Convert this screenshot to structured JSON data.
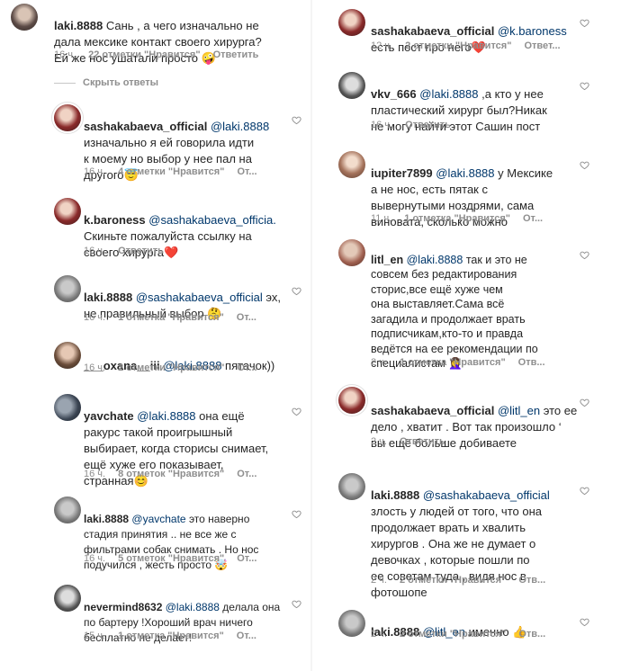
{
  "left": [
    {
      "user": "laki.8888",
      "text": "Сань , а чего изначально не\nдала мексике контакт своего хирурга?\nЕй же нос ушатали просто 🤪",
      "time": "16 ч.",
      "likes": "22 отметки \"Нравится\"",
      "reply": "Ответить"
    },
    {
      "user": "sashakabaeva_official",
      "mention": "@laki.8888",
      "text": "изначально я ей говорила идти\nк моему но выбор у нее пал на\nдругого😇",
      "time": "16 ч.",
      "likes": "4 отметки \"Нравится\"",
      "reply": "От..."
    },
    {
      "user": "k.baroness",
      "mention": "@sashakabaeva_officia.",
      "text": "Скиньте пожалуйста ссылку на\nсвоего хирурга❤️",
      "time": "16 ч.",
      "likes": "",
      "reply": "Ответить"
    },
    {
      "user": "laki.8888",
      "mention": "@sashakabaeva_official",
      "text_tail": " эх,",
      "text": "не правильный выбор 🤔",
      "time": "16 ч.",
      "likes": "1 отметка \"Нравится\"",
      "reply": "От..."
    },
    {
      "user": "___oxana__iii",
      "mention": "@laki.8888",
      "text_tail": " пятачок))",
      "time": "16 ч.",
      "likes": "2 отметки \"Нравится\"",
      "reply": "От..."
    },
    {
      "user": "yavchate",
      "mention": "@laki.8888",
      "text_tail": " она ещё",
      "text": "ракурс такой проигрышный\nвыбирает, когда сторисы снимает,\nещё хуже его показывает,\nстранная😊",
      "time": "16 ч.",
      "likes": "8 отметок \"Нравится\"",
      "reply": "От..."
    },
    {
      "user": "laki.8888",
      "mention": "@yavchate",
      "text_tail": " это наверно",
      "text": "стадия принятия .. не все же с\nфильтрами собак снимать . Но нос\nподучился , жесть просто 🤯",
      "time": "16 ч.",
      "likes": "5 отметок \"Нравится\"",
      "reply": "От..."
    },
    {
      "user": "nevermind8632",
      "mention": "@laki.8888",
      "text_tail": " делала она",
      "text": "по бартеру !Хороший врач ничего\nбесплатно не делает!",
      "time": "15 ч.",
      "likes": "1 отметка \"Нравится\"",
      "reply": "От..."
    }
  ],
  "hide_replies": "Скрыть ответы",
  "right": [
    {
      "user": "sashakabaeva_official",
      "mention": "@k.baroness",
      "text": "есть пост про него❤️",
      "time": "12 ч.",
      "likes": "2 отметки \"Нравится\"",
      "reply": "Ответ..."
    },
    {
      "user": "vkv_666",
      "mention": "@laki.8888",
      "text_tail": " ,а кто у нее",
      "text": "пластический хирург был?Никак\nне могу найти этот Сашин пост",
      "time": "16 ч.",
      "likes": "",
      "reply": "Ответить"
    },
    {
      "user": "iupiter7899",
      "mention": "@laki.8888",
      "text_tail": " у Мексике",
      "text": "а не нос, есть пятак с\nвывернутыми ноздрями, сама\nвиновата, сколько можно",
      "time": "11 ч.",
      "likes": "1 отметка \"Нравится\"",
      "reply": "От..."
    },
    {
      "user": "litl_en",
      "mention": "@laki.8888",
      "text_tail": " так и это не",
      "text": "совсем без редактирования\nсторис,все ещё хуже чем\nона выставляет.Сама всё\nзагадила и продолжает врать\nподписчикам,кто-то и правда\nведётся на ее рекомендации по\nспециалистам 🤦‍♀️",
      "time": "2 ч.",
      "likes": "1 отметка \"Нравится\"",
      "reply": "Отв..."
    },
    {
      "user": "sashakabaeva_official",
      "mention": "@litl_en",
      "text_tail": " это ее",
      "text": "дело , хватит . Вот так произошло ‘\nвы ещё больше добиваете",
      "time": "2 ч.",
      "likes": "",
      "reply": "Ответить"
    },
    {
      "user": "laki.8888",
      "mention": "@sashakabaeva_official",
      "text": "злость у людей от того, что она\nпродолжает врать и хвалить\nхирургов .  Она же не думает о\nдевочках , которые пошли по\nее советам туда , видя нос в\nфотошопе",
      "time": "2 ч.",
      "likes": "2 отметки \"Нравится\"",
      "reply": "Отв..."
    },
    {
      "user": "laki.8888",
      "mention": "@litl_en",
      "text_tail": " именно 👍",
      "time": "2 ч.",
      "likes": "2 отметки \"Нравится\"",
      "reply": "Отв..."
    }
  ],
  "icons": {
    "heart": "heart-outline-icon"
  }
}
